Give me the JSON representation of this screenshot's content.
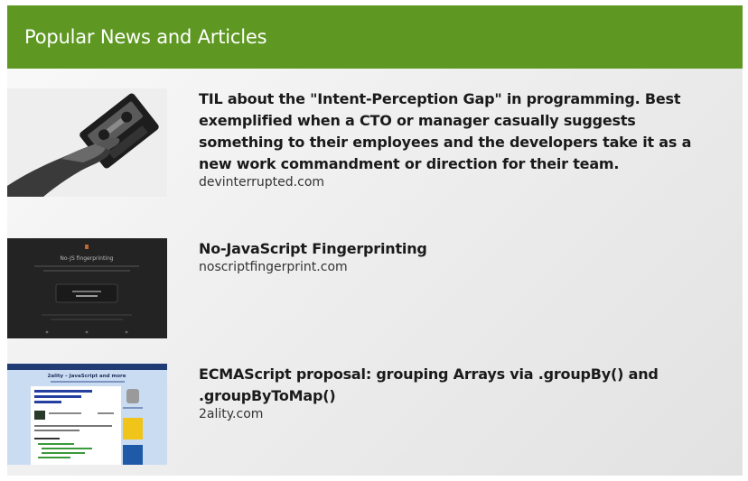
{
  "header": {
    "title": "Popular News and Articles"
  },
  "articles": [
    {
      "title": "TIL about the \"Intent-Perception Gap\" in programming. Best exemplified when a CTO or manager casually suggests something to their employees and the developers take it as a new work commandment or direction for their team.",
      "source": "devinterrupted.com",
      "thumbnail": "hand-holding-cassette-tape"
    },
    {
      "title": "No-JavaScript Fingerprinting",
      "source": "noscriptfingerprint.com",
      "thumbnail": "dark-website-screenshot",
      "thumb_heading": "No-JS fingerprinting"
    },
    {
      "title": "ECMAScript proposal: grouping Arrays via .groupBy() and .groupByToMap()",
      "source": "2ality.com",
      "thumbnail": "blog-website-screenshot",
      "thumb_heading": "2ality – JavaScript and more"
    }
  ],
  "colors": {
    "header_bg": "#5e9822",
    "header_text": "#ffffff",
    "title_text": "#1a1a1a",
    "source_text": "#333333"
  }
}
